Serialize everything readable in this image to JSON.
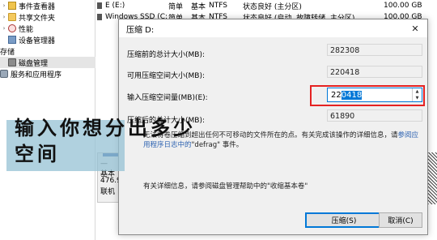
{
  "tree": {
    "items": [
      {
        "label": "事件查看器",
        "icon": "event-viewer-icon",
        "expand": "›"
      },
      {
        "label": "共享文件夹",
        "icon": "shared-folder-icon",
        "expand": "›"
      },
      {
        "label": "性能",
        "icon": "performance-icon",
        "expand": "›"
      },
      {
        "label": "设备管理器",
        "icon": "device-manager-icon",
        "expand": ""
      },
      {
        "label": "存储",
        "icon": "",
        "expand": "⌄"
      },
      {
        "label": "磁盘管理",
        "icon": "disk-management-icon",
        "expand": ""
      },
      {
        "label": "服务和应用程序",
        "icon": "services-icon",
        "expand": "›"
      }
    ]
  },
  "volumes": [
    {
      "name": "E (E:)",
      "layout": "简单",
      "type": "基本",
      "fs": "NTFS",
      "status": "状态良好 (主分区)",
      "capacity": "100.00 GB"
    },
    {
      "name": "Windows SSD (C:)",
      "layout": "简单",
      "type": "基本",
      "fs": "NTFS",
      "status": "状态良好 (启动, 故障转储, 主分区)",
      "capacity": "100.00 GB"
    }
  ],
  "dialog": {
    "title": "压缩 D:",
    "close_glyph": "✕",
    "total_before_label": "压缩前的总计大小(MB):",
    "total_before_value": "282308",
    "available_label": "可用压缩空间大小(MB):",
    "available_value": "220418",
    "input_label": "输入压缩空间量(MB)(E):",
    "input_value_prefix": "22",
    "input_value_selected": "0418",
    "total_after_label": "压缩后的总计大小(MB):",
    "total_after_value": "61890",
    "note_prefix": "无法将卷压缩到超出任何不可移动的文件所在的点。有关完成该操作的详细信息，请",
    "note_link_part": "参阅应用程序日志中的",
    "note_suffix": "\"defrag\" 事件。",
    "info_text": "有关详细信息，请参阅磁盘管理帮助中的\"收缩基本卷\"",
    "shrink_button": "压缩(S)",
    "cancel_button": "取消(C)"
  },
  "disk": {
    "label_lines": [
      "基本",
      "476.9",
      "联机"
    ],
    "dash": "—"
  },
  "overlay": {
    "line1": "输入你想分出多少",
    "line2": "空间"
  },
  "colors": {
    "accent": "#0078d7",
    "highlight_box": "#e52222",
    "overlay_bg": "#96c2d4"
  }
}
